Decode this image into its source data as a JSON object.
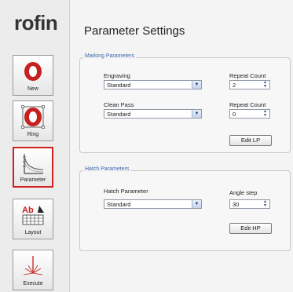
{
  "brand": {
    "logo_text": "rofin"
  },
  "sidebar": {
    "items": [
      {
        "label": "New",
        "icon": "new-icon"
      },
      {
        "label": "Ring",
        "icon": "ring-icon"
      },
      {
        "label": "Parameter",
        "icon": "parameter-icon",
        "active": true
      },
      {
        "label": "Layout",
        "icon": "layout-icon"
      },
      {
        "label": "Execute",
        "icon": "execute-icon"
      }
    ],
    "active_color": "#d21f1f"
  },
  "page": {
    "title": "Parameter Settings"
  },
  "marking": {
    "legend": "Marking Parameters",
    "engraving": {
      "label": "Engraving",
      "value": "Standard"
    },
    "engraving_repeat": {
      "label": "Repeat Count",
      "value": "2"
    },
    "clean_pass": {
      "label": "Clean Pass",
      "value": "Standard"
    },
    "clean_repeat": {
      "label": "Repeat Count",
      "value": "0"
    },
    "edit_button": "Edit LP"
  },
  "hatch": {
    "legend": "Hatch Parameters",
    "hatch_param": {
      "label": "Hatch Parameter",
      "value": "Standard"
    },
    "angle_step": {
      "label": "Angle step",
      "value": "30"
    },
    "edit_button": "Edit HP"
  },
  "colors": {
    "legend_text": "#3a66b0",
    "accent_ring": "#c62020"
  }
}
